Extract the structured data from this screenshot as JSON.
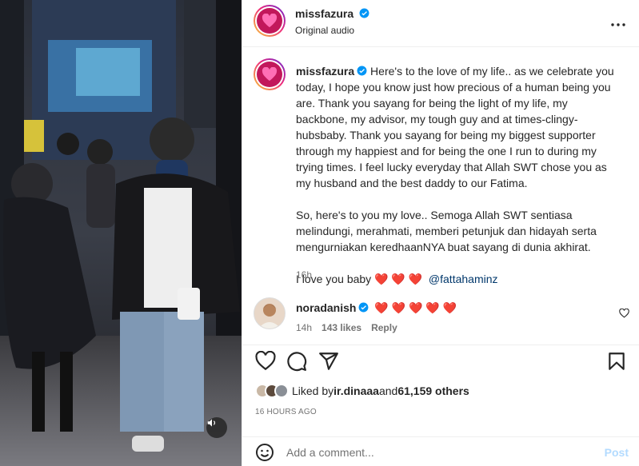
{
  "post": {
    "author": "missfazura",
    "audio": "Original audio",
    "caption": "Here's to the love of my life.. as we celebrate you today, I hope you know just how precious of a human being you are. Thank you sayang for being the light of my life, my backbone, my advisor, my tough guy and at times-clingy-hubsbaby. Thank you sayang for being my biggest supporter through my happiest and for being the one I run to during my trying times. I feel lucky everyday that Allah SWT chose you as my husband and the best daddy to our Fatima.\n\nSo, here's to you my love.. Semoga Allah SWT sentiasa melindungi, merahmati, memberi petunjuk dan hidayah serta mengurniakan keredhaanNYA buat sayang di dunia akhirat.",
    "closing_text": "I love you baby ",
    "closing_emoji": "❤️ ❤️ ❤️",
    "mention": "@fattahaminz",
    "caption_time": "16h",
    "time_ago": "16 HOURS AGO"
  },
  "comment": {
    "author": "noradanish",
    "text": "❤️ ❤️ ❤️ ❤️ ❤️",
    "time": "14h",
    "likes": "143 likes",
    "reply_label": "Reply"
  },
  "likes": {
    "prefix": "Liked by ",
    "user": "ir.dinaaa",
    "middle": " and ",
    "count": "61,159 others"
  },
  "comment_box": {
    "placeholder": "Add a comment...",
    "post_label": "Post"
  },
  "icons": {
    "more": "more-options-icon",
    "like": "heart-icon",
    "comment": "comment-icon",
    "share": "share-icon",
    "save": "bookmark-icon",
    "emoji": "emoji-icon",
    "mute": "sound-on-icon",
    "verified": "verified-badge-icon"
  },
  "colors": {
    "verified": "#0095f6",
    "heart": "#ff3040",
    "link": "#00376b",
    "post_disabled": "#b3dbff",
    "muted_text": "#737373"
  }
}
